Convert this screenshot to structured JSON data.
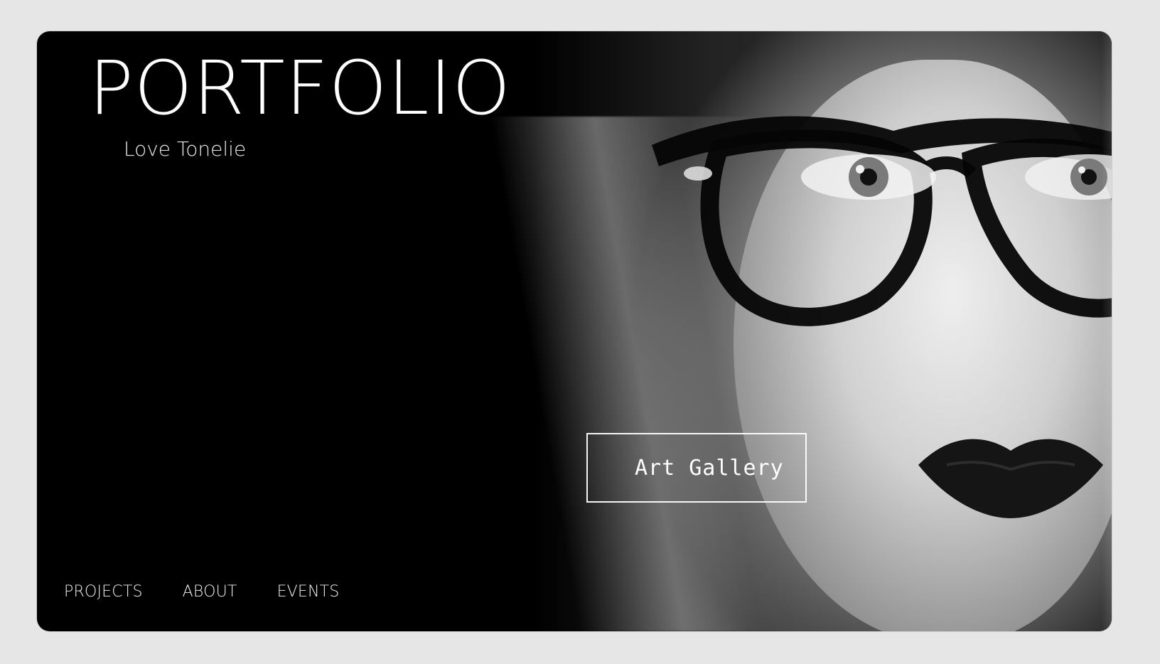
{
  "hero": {
    "title": "PORTFOLIO",
    "subtitle": "Love Tonelie",
    "cta_label": "Art Gallery"
  },
  "nav": {
    "items": [
      {
        "label": "PROJECTS"
      },
      {
        "label": "ABOUT"
      },
      {
        "label": "EVENTS"
      }
    ]
  },
  "theme": {
    "page_bg": "#e6e6e6",
    "hero_bg": "#000000",
    "text": "#ffffff"
  }
}
